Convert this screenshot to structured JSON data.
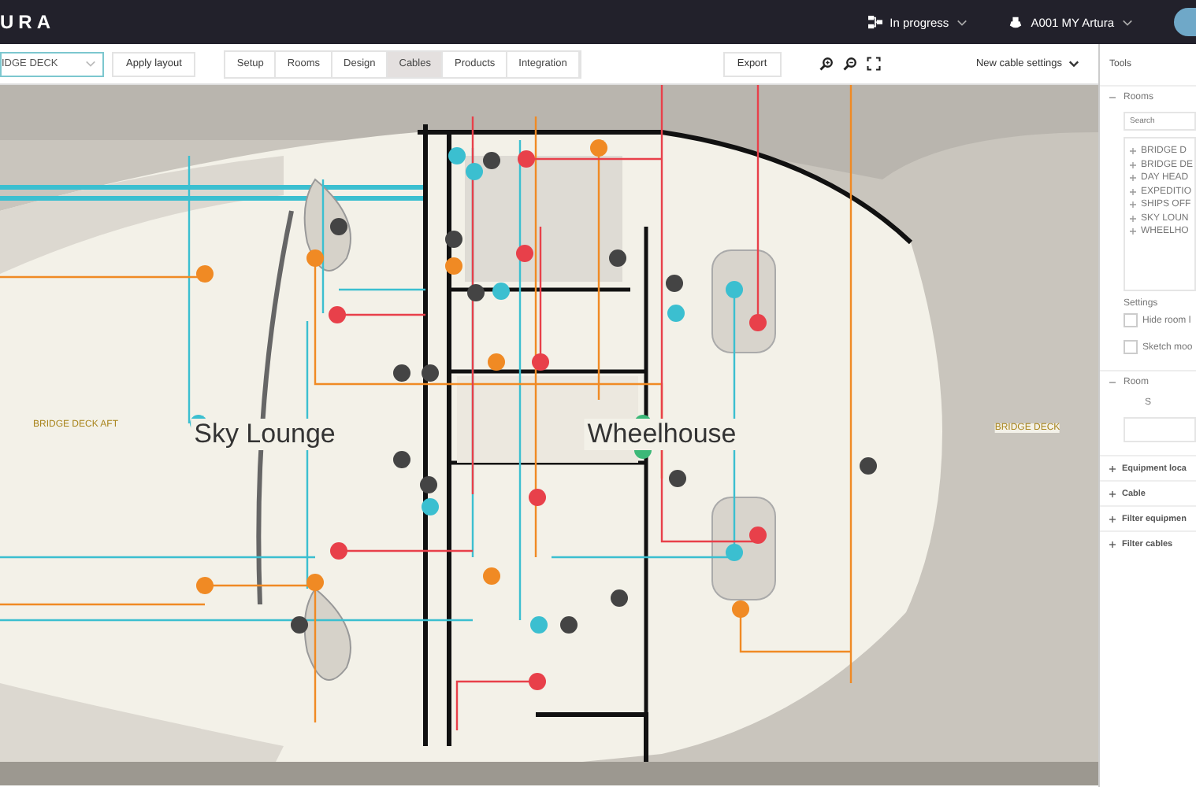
{
  "app": {
    "logo": "URA",
    "status": "In progress",
    "project": "A001 MY Artura"
  },
  "toolbar": {
    "deck": "IDGE DECK",
    "apply": "Apply layout",
    "export": "Export",
    "cable_settings": "New cable settings",
    "tabs": [
      {
        "label": "Setup",
        "selected": false
      },
      {
        "label": "Rooms",
        "selected": false
      },
      {
        "label": "Design",
        "selected": false
      },
      {
        "label": "Cables",
        "selected": true
      },
      {
        "label": "Products",
        "selected": false
      },
      {
        "label": "Integration",
        "selected": false
      }
    ]
  },
  "plan": {
    "rooms": [
      {
        "label": "BRIDGE DECK AFT",
        "kind": "zone"
      },
      {
        "label": "Sky Lounge",
        "kind": "room"
      },
      {
        "label": "Wheelhouse",
        "kind": "room"
      },
      {
        "label": "BRIDGE DECK",
        "kind": "zone"
      }
    ]
  },
  "tools": {
    "title": "Tools",
    "rooms": {
      "title": "Rooms",
      "expanded": true,
      "search_placeholder": "Search",
      "items": [
        "BRIDGE D",
        "BRIDGE DE",
        "DAY HEAD",
        "EXPEDITIO",
        "SHIPS OFF",
        "SKY LOUN",
        "WHEELHO"
      ]
    },
    "settings": {
      "title": "Settings",
      "options": [
        {
          "label": "Hide room l",
          "checked": false
        },
        {
          "label": "Sketch moo",
          "checked": false
        }
      ]
    },
    "room": {
      "title": "Room",
      "expanded": true,
      "label": "S"
    },
    "sections": [
      {
        "title": "Equipment loca",
        "expanded": false
      },
      {
        "title": "Cable",
        "expanded": false
      },
      {
        "title": "Filter equipmen",
        "expanded": false
      },
      {
        "title": "Filter cables",
        "expanded": false
      }
    ]
  }
}
